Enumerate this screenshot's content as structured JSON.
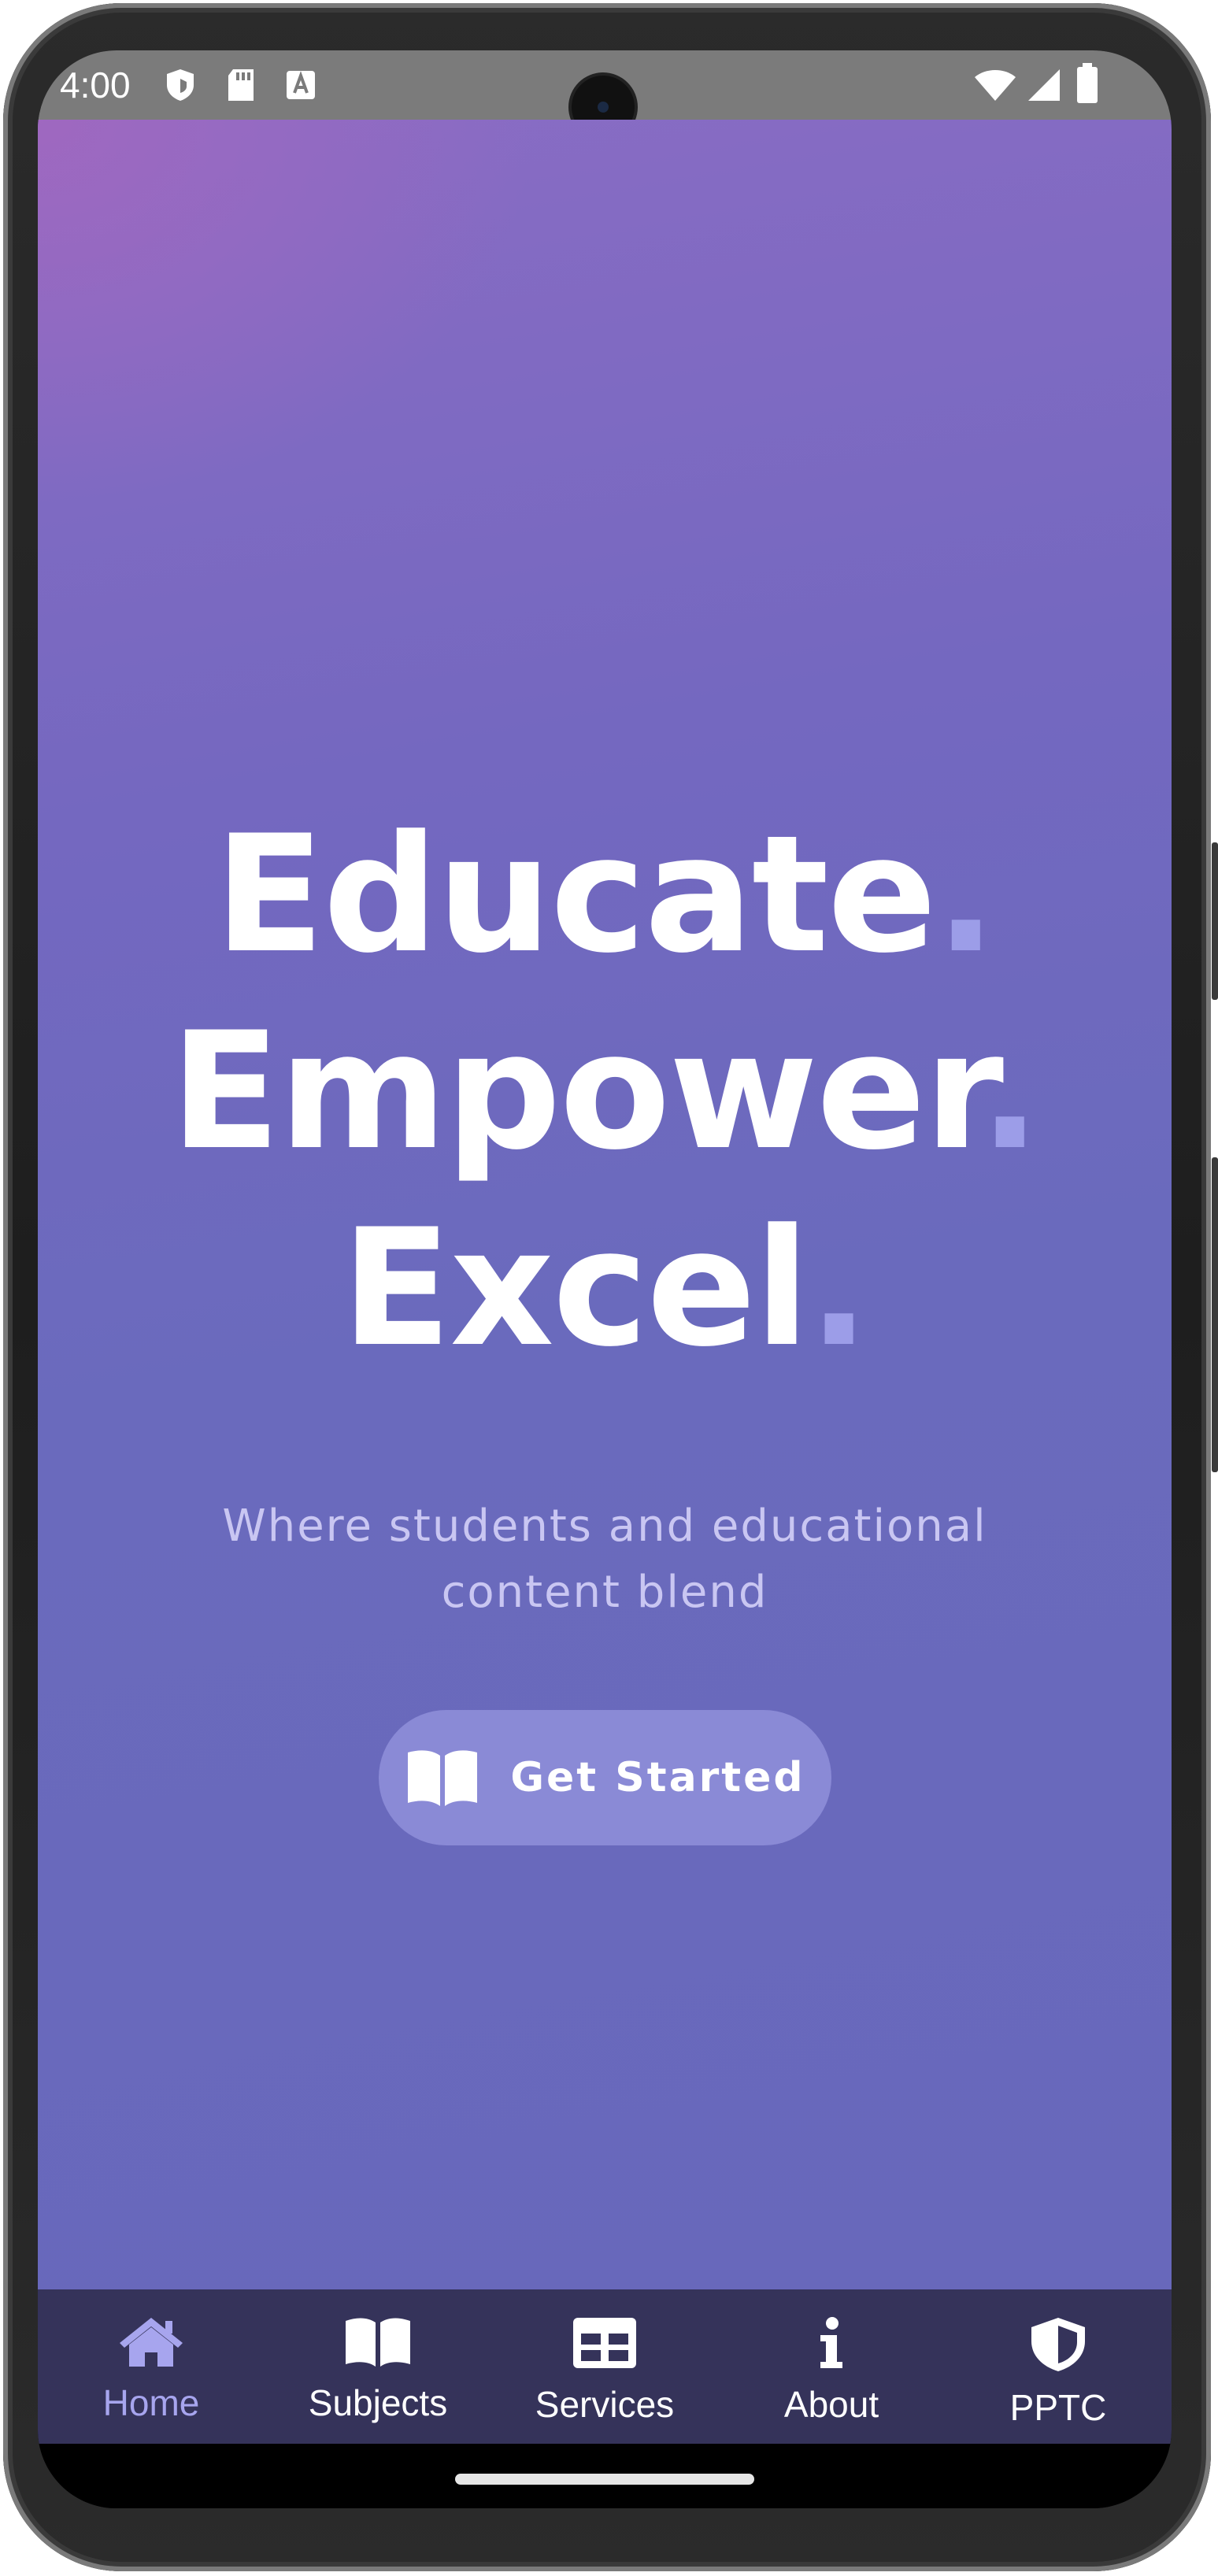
{
  "status_bar": {
    "time": "4:00",
    "left_icons": [
      "shield-icon",
      "sd-card-icon",
      "text-a-icon"
    ],
    "right_icons": [
      "wifi-icon",
      "signal-icon",
      "battery-icon"
    ]
  },
  "hero": {
    "lines": [
      {
        "word": "Educate",
        "dot": "."
      },
      {
        "word": "Empower",
        "dot": "."
      },
      {
        "word": "Excel",
        "dot": "."
      }
    ],
    "subtitle": "Where students and educational content blend",
    "cta_label": "Get Started",
    "cta_icon": "open-book-icon"
  },
  "nav": {
    "items": [
      {
        "label": "Home",
        "icon": "home-icon",
        "active": true
      },
      {
        "label": "Subjects",
        "icon": "open-book-icon",
        "active": false
      },
      {
        "label": "Services",
        "icon": "table-icon",
        "active": false
      },
      {
        "label": "About",
        "icon": "info-icon",
        "active": false
      },
      {
        "label": "PPTC",
        "icon": "shield-icon",
        "active": false
      }
    ]
  },
  "colors": {
    "accent_dot": "#9c9de8",
    "nav_background": "#35335a",
    "nav_active": "#a7a5ee",
    "cta_background": "#8a8ad6"
  }
}
